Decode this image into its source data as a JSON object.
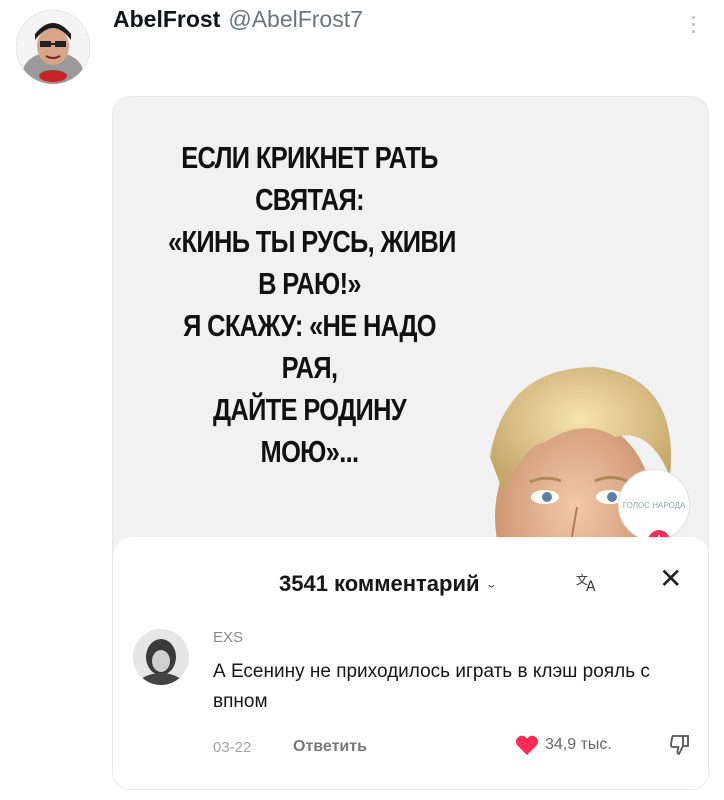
{
  "tweet": {
    "display_name": "AbelFrost",
    "handle": "@AbelFrost7",
    "more_icon": "more-vertical-icon"
  },
  "poster": {
    "lines": [
      "ЕСЛИ КРИКНЕТ РАТЬ",
      "СВЯТАЯ:",
      "«КИНЬ ТЫ РУСЬ, ЖИВИ",
      "В РАЮ!»",
      "Я СКАЖУ: «НЕ НАДО",
      "РАЯ,",
      "ДАЙТЕ РОДИНУ",
      "МОЮ»..."
    ],
    "badge_text": "ГОЛОС НАРОДА"
  },
  "comments_sheet": {
    "title": "3541 комментарий",
    "translate_icon": "translate-icon",
    "close_icon": "close-icon",
    "comment": {
      "username": "EXS",
      "text": "А Есенину не приходилось играть в клэш рояль с впном",
      "date": "03-22",
      "reply_label": "Ответить",
      "likes": "34,9 тыс.",
      "like_color": "#fe2c55"
    }
  }
}
